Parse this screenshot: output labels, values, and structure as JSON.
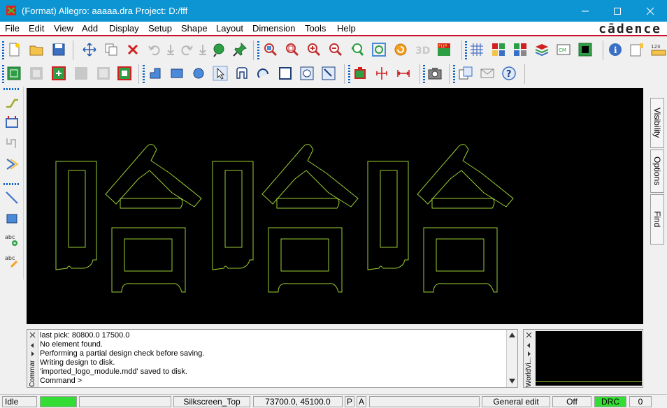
{
  "window": {
    "title": "(Format) Allegro: aaaaa.dra  Project: D:/fff",
    "minimize_icon": "minimize-icon",
    "maximize_icon": "maximize-icon",
    "close_icon": "close-icon"
  },
  "menu": {
    "items": [
      {
        "label": "File"
      },
      {
        "label": "Edit"
      },
      {
        "label": "View"
      },
      {
        "label": "Add"
      },
      {
        "label": "Display"
      },
      {
        "label": "Setup"
      },
      {
        "label": "Shape"
      },
      {
        "label": "Layout"
      },
      {
        "label": "Dimension"
      },
      {
        "label": "Tools"
      },
      {
        "label": "Help"
      }
    ]
  },
  "brand": {
    "logo": "cādence",
    "color": "#c8102e"
  },
  "toolbar": {
    "top_row": [
      "new-file",
      "open-folder",
      "save",
      "move",
      "copy",
      "delete",
      "undo",
      "redo-disabled",
      "redo",
      "pick-disabled",
      "glossary",
      "pin",
      "zoom-fit",
      "zoom-points",
      "zoom-in",
      "zoom-out",
      "zoom-previous",
      "zoom-world",
      "refresh",
      "3d-view",
      "flip",
      "grid",
      "color-layers",
      "color-dialog",
      "layer-stack",
      "cm-manager",
      "shadow",
      "info",
      "status",
      "ruler-123"
    ],
    "second_row": [
      "symbol-layer",
      "disabled-layer",
      "layer",
      "disabled-layer-2",
      "disabled-layer-3",
      "layer-frame",
      "add-line",
      "add-rect",
      "add-circle",
      "select",
      "add-shape",
      "arc",
      "rect-outline",
      "frame",
      "frame-2",
      "part",
      "dim-vertical",
      "dim-horizontal",
      "camera",
      "copy-table",
      "email",
      "help"
    ],
    "left_column": [
      "route",
      "place",
      "stub",
      "chevron",
      "line",
      "rectangle",
      "add-text",
      "edit-text"
    ]
  },
  "canvas": {
    "background": "#000000",
    "outline_color": "#9acd32"
  },
  "side_tabs": {
    "visibility": "Visibility",
    "options": "Options",
    "find": "Find"
  },
  "command": {
    "panel_label": "Command",
    "lines": [
      "last pick:  80800.0 17500.0",
      "No element found.",
      "Performing a partial design check before saving.",
      "Writing design to disk.",
      "'imported_logo_module.mdd' saved to disk.",
      "Command >"
    ]
  },
  "world_view": {
    "label": "WorldVi..."
  },
  "status": {
    "mode": "Idle",
    "active_color": "#33dd33",
    "layer": "Silkscreen_Top",
    "coords": "73700.0, 45100.0",
    "p_btn": "P",
    "a_btn": "A",
    "edit_mode": "General edit",
    "off": "Off",
    "drc": "DRC",
    "drc_color": "#33dd33",
    "count": "0"
  }
}
